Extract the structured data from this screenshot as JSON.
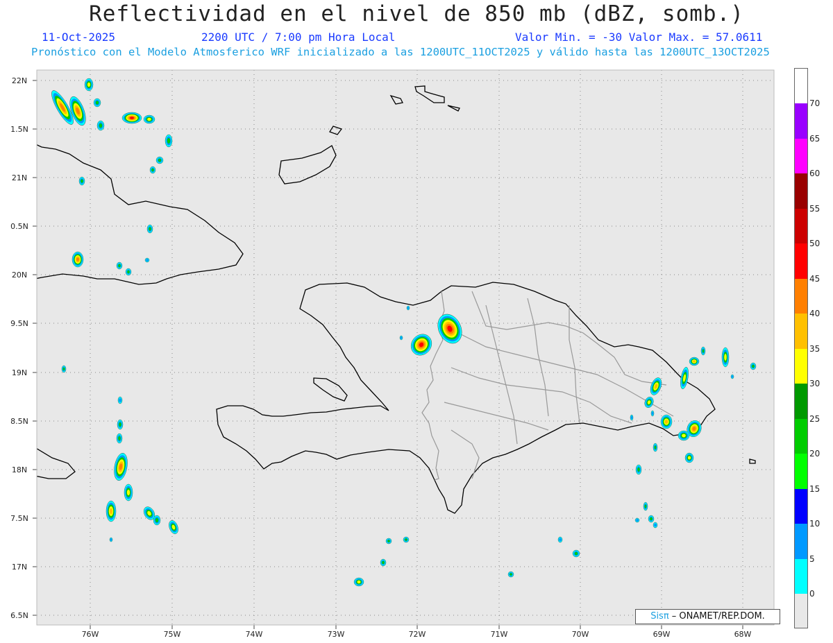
{
  "title": "Reflectividad en el nivel de 850 mb (dBZ, somb.)",
  "header": {
    "date": "11-Oct-2025",
    "time": "2200 UTC / 7:00 pm Hora Local",
    "values": "Valor Min. = -30  Valor Max. = 57.0611",
    "model": "Pronóstico con el Modelo Atmosferico WRF inicializado a las 1200UTC_11OCT2025 y válido hasta las  1200UTC_13OCT2025"
  },
  "axes": {
    "lat_labels": [
      "22N",
      "1.5N",
      "21N",
      "0.5N",
      "20N",
      "9.5N",
      "19N",
      "8.5N",
      "18N",
      "7.5N",
      "17N",
      "6.5N"
    ],
    "lon_labels": [
      "76W",
      "75W",
      "74W",
      "73W",
      "72W",
      "71W",
      "70W",
      "69W",
      "68W"
    ]
  },
  "credit": {
    "logo": "Sisπ",
    "text": " – ONAMET/REP.DOM."
  },
  "colorbar": {
    "labels": [
      "70",
      "65",
      "60",
      "55",
      "50",
      "45",
      "40",
      "35",
      "30",
      "25",
      "20",
      "15",
      "10",
      "5",
      "0"
    ],
    "colors": [
      "#9900ff",
      "#ff00ff",
      "#990000",
      "#cc0000",
      "#ff0000",
      "#ff7f00",
      "#ffc000",
      "#ffff00",
      "#009900",
      "#00cc00",
      "#00ff00",
      "#0000ff",
      "#0099ff",
      "#00ffff",
      "#e8e8e8"
    ]
  },
  "map_colors": {
    "background": "#e8e8e8",
    "coast": "#000000",
    "borders": "#999999",
    "grid": "#888888"
  }
}
